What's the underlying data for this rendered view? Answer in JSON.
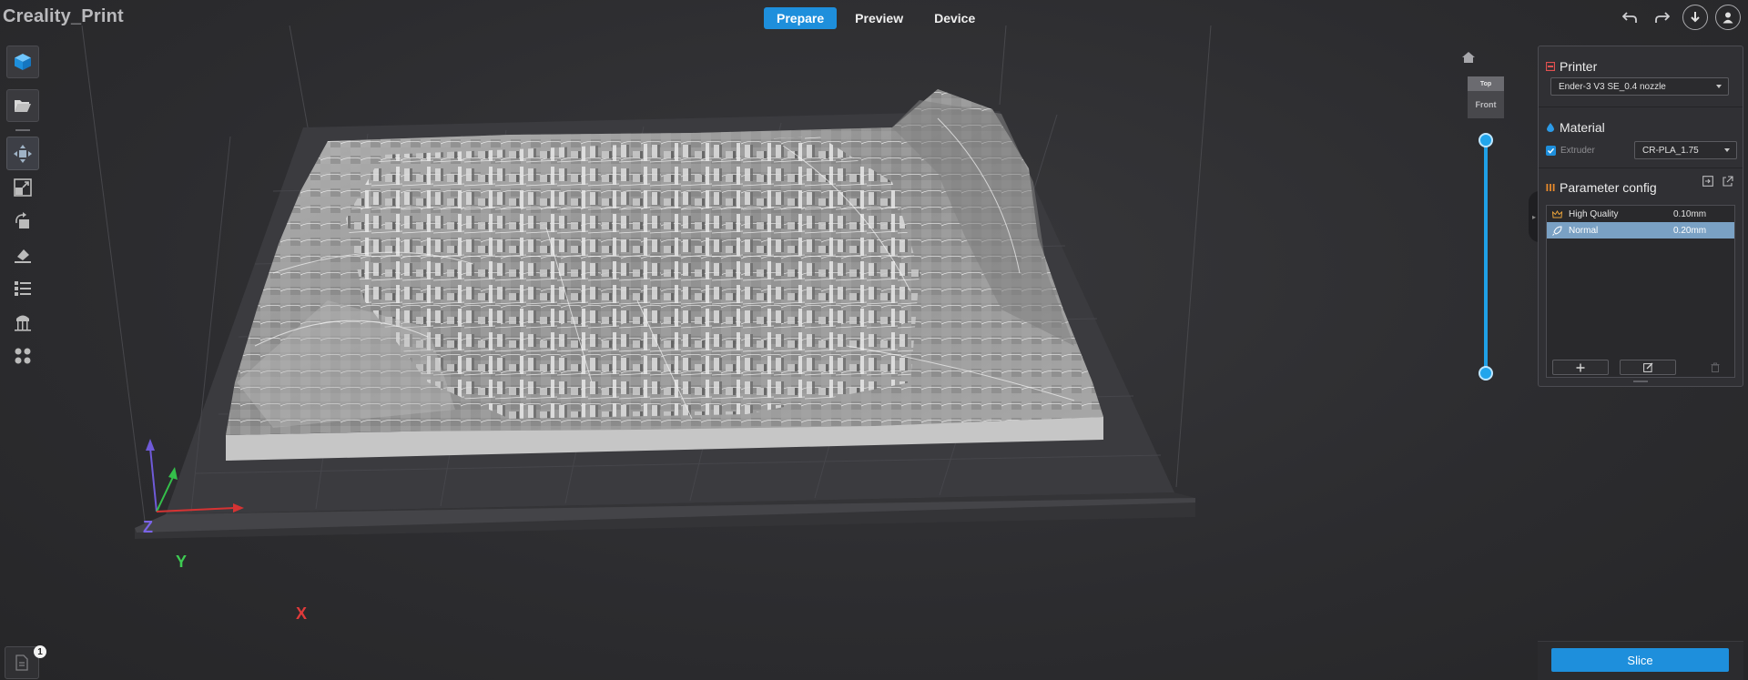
{
  "app": {
    "title": "Creality_Print"
  },
  "header": {
    "tabs": [
      {
        "label": "Prepare",
        "active": true
      },
      {
        "label": "Preview",
        "active": false
      },
      {
        "label": "Device",
        "active": false
      }
    ],
    "actions": [
      "undo-icon",
      "redo-icon",
      "download-icon",
      "user-icon"
    ]
  },
  "left_toolbar": [
    "cube-icon",
    "open-folder-icon",
    "move-icon",
    "scale-icon",
    "rotate-icon",
    "lay-flat-icon",
    "list-icon",
    "support-icon",
    "arrange-icon"
  ],
  "view_cube": {
    "top": "Top",
    "front": "Front"
  },
  "axes": {
    "x": "X",
    "y": "Y",
    "z": "Z"
  },
  "printer": {
    "title": "Printer",
    "selected": "Ender-3 V3 SE_0.4 nozzle"
  },
  "material": {
    "title": "Material",
    "extruder_label": "Extruder",
    "extruder_checked": true,
    "selected": "CR-PLA_1.75"
  },
  "parameter_config": {
    "title": "Parameter config",
    "profiles": [
      {
        "name": "High Quality",
        "layer": "0.10mm",
        "icon": "crown-icon",
        "selected": false
      },
      {
        "name": "Normal",
        "layer": "0.20mm",
        "icon": "rocket-icon",
        "selected": true
      }
    ]
  },
  "slice": {
    "label": "Slice"
  },
  "plates": {
    "count": "1"
  },
  "colors": {
    "accent": "#1e8fdc",
    "selected_row": "#7aa1c4",
    "bed": "#3c3c40",
    "model": "#9a9a9a"
  }
}
